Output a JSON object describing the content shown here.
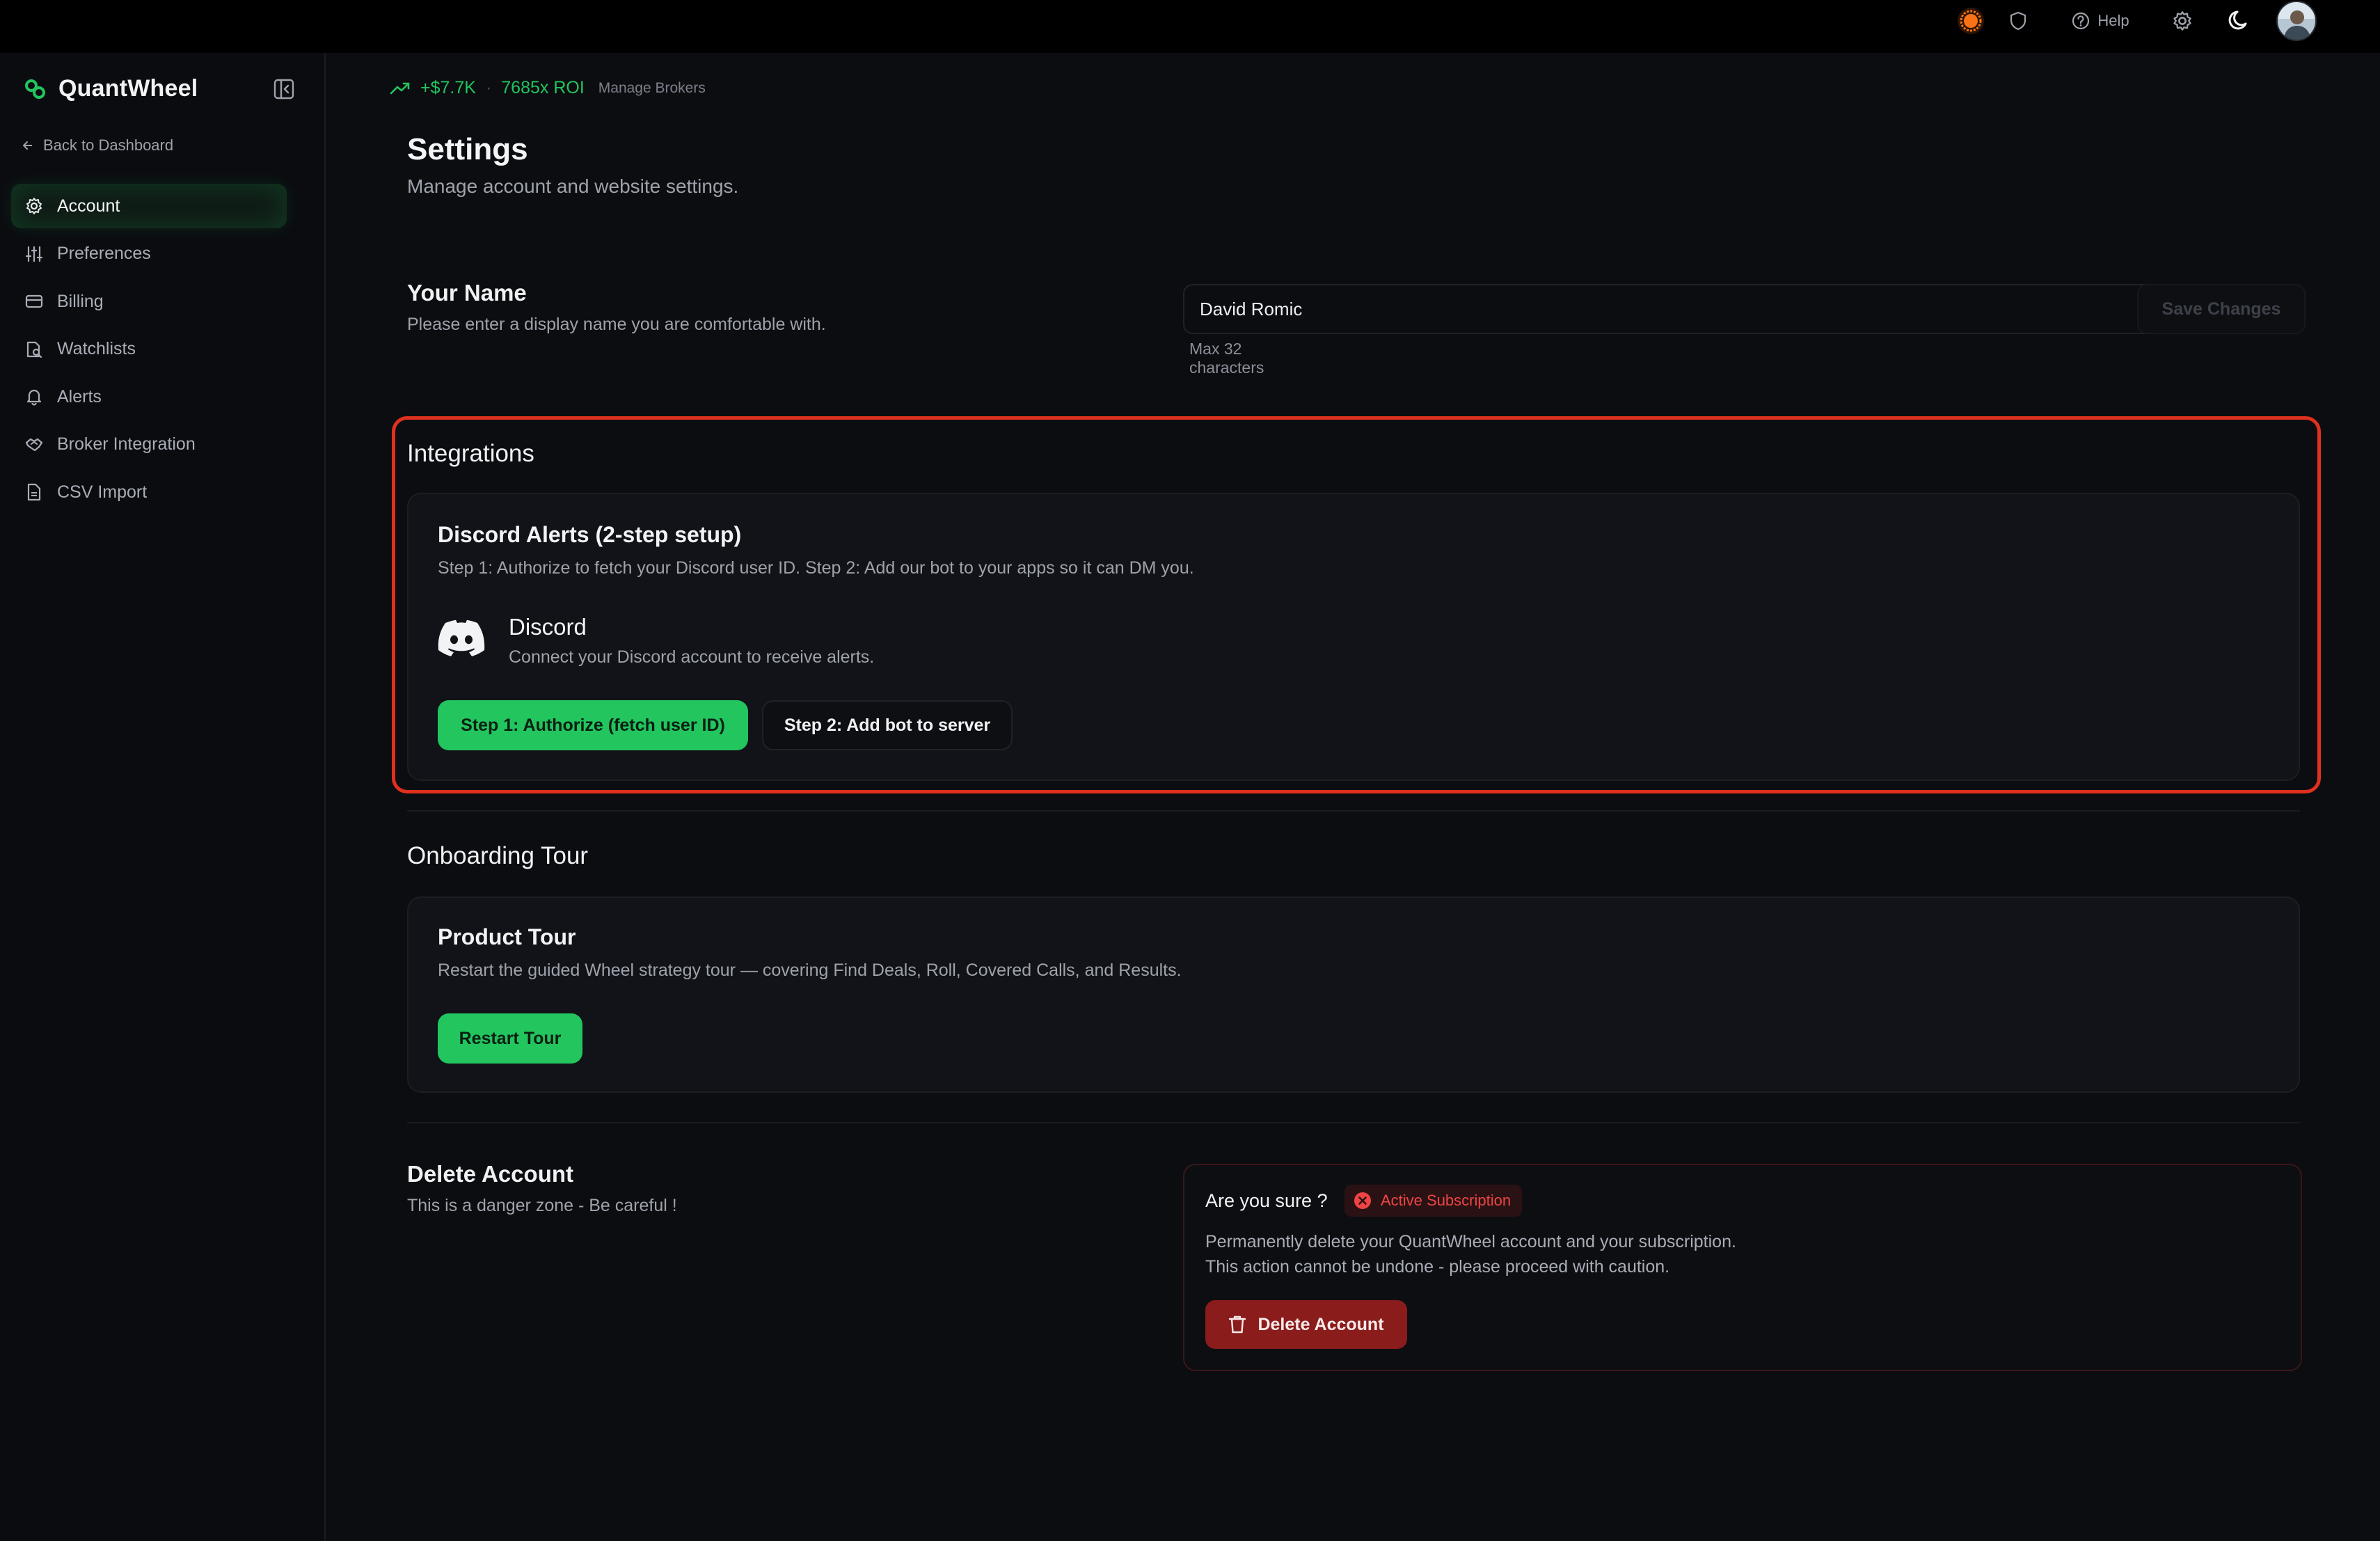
{
  "app": {
    "name": "QuantWheel",
    "brand_color": "#22c55e"
  },
  "sidebar": {
    "back_label": "Back to Dashboard",
    "items": [
      {
        "label": "Account",
        "icon": "gear-icon",
        "active": true
      },
      {
        "label": "Preferences",
        "icon": "sliders-icon",
        "active": false
      },
      {
        "label": "Billing",
        "icon": "credit-card-icon",
        "active": false
      },
      {
        "label": "Watchlists",
        "icon": "watchlist-icon",
        "active": false
      },
      {
        "label": "Alerts",
        "icon": "bell-icon",
        "active": false
      },
      {
        "label": "Broker Integration",
        "icon": "handshake-icon",
        "active": false
      },
      {
        "label": "CSV Import",
        "icon": "file-icon",
        "active": false
      }
    ]
  },
  "header": {
    "pnl": "+$7.7K",
    "separator": "·",
    "roi": "7685x ROI",
    "manage_brokers": "Manage Brokers",
    "help": "Help"
  },
  "page": {
    "title": "Settings",
    "subtitle": "Manage account and website settings."
  },
  "your_name": {
    "title": "Your Name",
    "subtitle": "Please enter a display name you are comfortable with.",
    "value": "David Romic",
    "hint": "Max 32 characters",
    "save_label": "Save Changes"
  },
  "integrations": {
    "title": "Integrations",
    "card_title": "Discord Alerts (2-step setup)",
    "card_subtitle": "Step 1: Authorize to fetch your Discord user ID. Step 2: Add our bot to your apps so it can DM you.",
    "provider_name": "Discord",
    "provider_desc": "Connect your Discord account to receive alerts.",
    "step1_label": "Step 1: Authorize (fetch user ID)",
    "step2_label": "Step 2: Add bot to server"
  },
  "onboarding": {
    "title": "Onboarding Tour",
    "card_title": "Product Tour",
    "card_subtitle": "Restart the guided Wheel strategy tour — covering Find Deals, Roll, Covered Calls, and Results.",
    "restart_label": "Restart Tour"
  },
  "delete_account": {
    "title": "Delete Account",
    "subtitle": "This is a danger zone - Be careful !",
    "confirm_title": "Are you sure ?",
    "badge": "Active Subscription",
    "line1": "Permanently delete your QuantWheel account and your subscription.",
    "line2": "This action cannot be undone - please proceed with caution.",
    "delete_label": "Delete Account"
  },
  "colors": {
    "danger": "#ef4444",
    "highlight": "#e0301e",
    "accent": "#22c55e"
  }
}
